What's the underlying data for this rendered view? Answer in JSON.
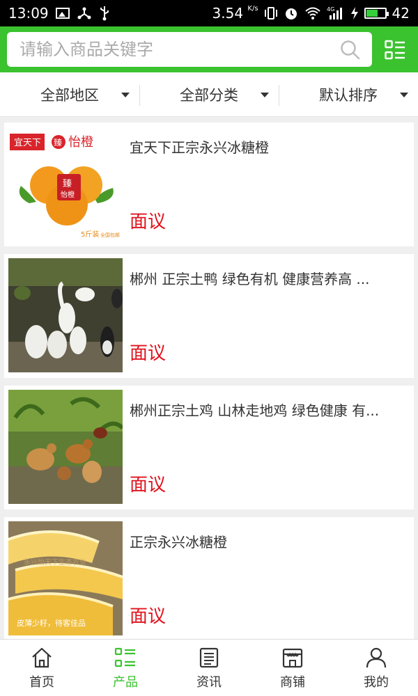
{
  "status_bar": {
    "time": "13:09",
    "speed": "3.54",
    "speed_unit": "K/s",
    "network": "4G",
    "battery": "42"
  },
  "search": {
    "placeholder": "请输入商品关键字",
    "value": ""
  },
  "filters": [
    {
      "label": "全部地区"
    },
    {
      "label": "全部分类"
    },
    {
      "label": "默认排序"
    }
  ],
  "products": [
    {
      "title": "宜天下正宗永兴冰糖橙",
      "price": "面议",
      "image_text": {
        "brand": "宜天下",
        "name": "臻 怡橙",
        "badge": "臻",
        "badge_sub": "怡橙",
        "pack": "5斤装",
        "ship": "全国包邮"
      },
      "image": "orange-product-image"
    },
    {
      "title": "郴州 正宗土鸭 绿色有机 健康营养高 ...",
      "price": "面议",
      "image": "ducks-image"
    },
    {
      "title": "郴州正宗土鸡 山林走地鸡 绿色健康 有...",
      "price": "面议",
      "image": "chickens-image"
    },
    {
      "title": "正宗永兴冰糖橙",
      "price": "面议",
      "image_text": {
        "overlay": "永兴怡天下生态农业",
        "caption": "皮薄少籽，待客佳品"
      },
      "image": "orange-slices-image"
    }
  ],
  "nav": [
    {
      "label": "首页",
      "icon": "home-icon"
    },
    {
      "label": "产品",
      "icon": "product-list-icon",
      "active": true
    },
    {
      "label": "资讯",
      "icon": "news-icon"
    },
    {
      "label": "商铺",
      "icon": "shop-icon"
    },
    {
      "label": "我的",
      "icon": "user-icon"
    }
  ],
  "colors": {
    "accent": "#3bc22f",
    "price": "#e0141e"
  }
}
